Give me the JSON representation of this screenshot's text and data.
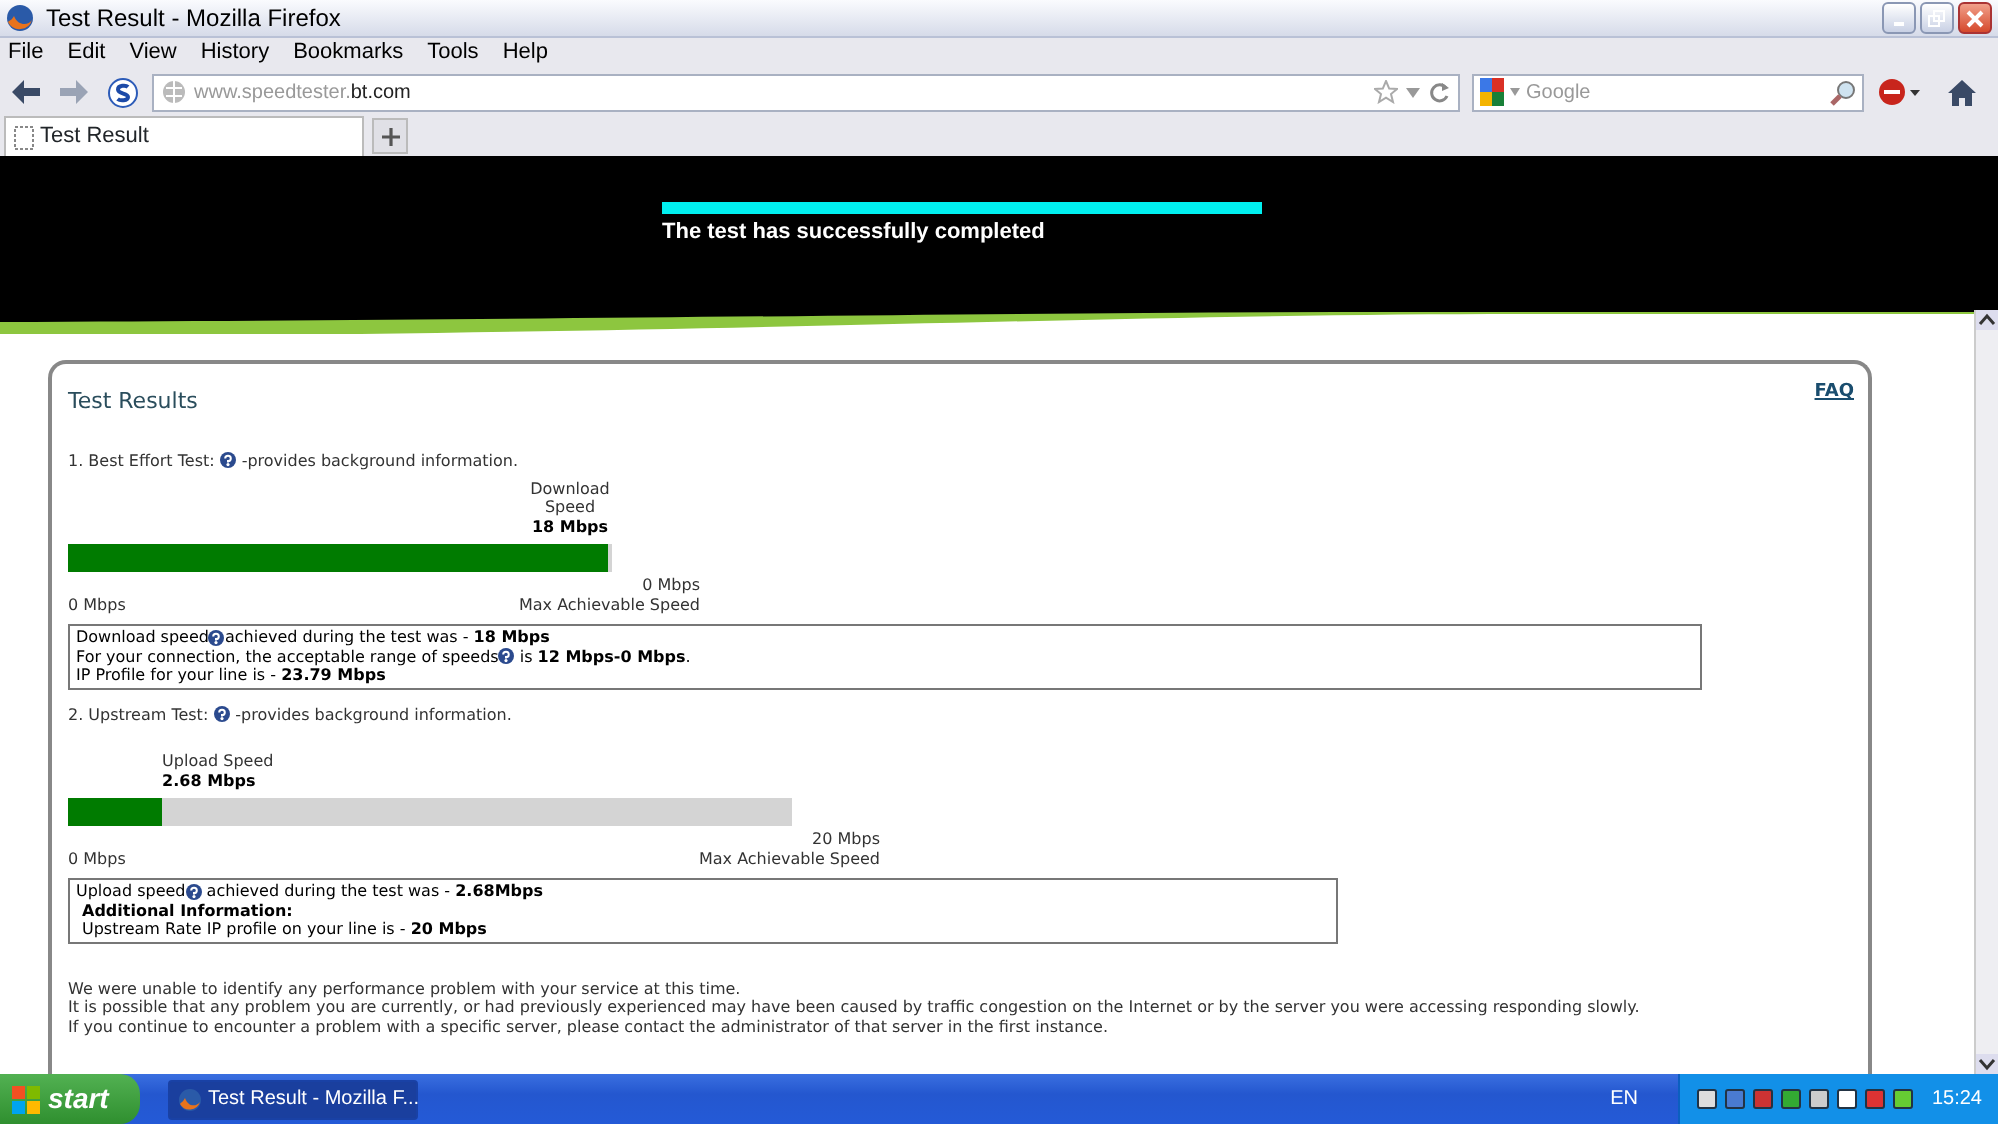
{
  "window": {
    "title": "Test Result - Mozilla Firefox"
  },
  "menu": [
    "File",
    "Edit",
    "View",
    "History",
    "Bookmarks",
    "Tools",
    "Help"
  ],
  "address": {
    "host": "www.speedtester.",
    "domain": "bt.com"
  },
  "search": {
    "placeholder": "Google"
  },
  "tabs": [
    {
      "label": "Test Result",
      "selected": true
    }
  ],
  "banner": {
    "level": 1,
    "message": "The test has successfully completed"
  },
  "results": {
    "title": "Test Results",
    "faq": "FAQ",
    "tests": [
      {
        "heading": "1. Best Effort Test:",
        "help_text": "-provides background information.",
        "bar_label": "Download Speed",
        "bar_value": "18 Mbps",
        "level": 1,
        "min": "0 Mbps",
        "max": "0 Mbps",
        "max_caption": "Max Achievable Speed",
        "info": [
          {
            "before": "Download speed",
            "help": true,
            "after": "achieved during the test was - **18 Mbps**"
          },
          {
            "before": "For your connection, the acceptable range of speeds",
            "help": true,
            "after": " is **12 Mbps-0 Mbps**."
          },
          {
            "before": "IP Profile for your line is - **23.79 Mbps**",
            "help": false
          }
        ]
      },
      {
        "heading": "2. Upstream Test:",
        "help_text": "-provides background information.",
        "bar_label": "Upload Speed",
        "bar_value": "2.68 Mbps",
        "level": 0.13,
        "min": "0 Mbps",
        "max": "20 Mbps",
        "max_caption": "Max Achievable Speed",
        "info": [
          {
            "before": "Upload speed",
            "help": true,
            "after": " achieved during the test was - **2.68Mbps**"
          },
          {
            "before": "Additional Information:",
            "help": false,
            "kind": "heading"
          },
          {
            "before": "Upstream Rate IP profile on your line is - **20 Mbps**",
            "help": false,
            "kind": "indent"
          }
        ]
      }
    ],
    "notes": [
      "We were unable to identify any performance problem with your service at this time.",
      "It is possible that any problem you are currently, or had previously experienced may have been caused by traffic congestion on the Internet or by the server you were accessing responding slowly.",
      "If you continue to encounter a problem with a specific server, please contact the administrator of that server in the first instance."
    ]
  },
  "taskbar": {
    "start": "start",
    "tasks": [
      {
        "label": "Test Result - Mozilla F...",
        "selected": true
      }
    ],
    "language": "EN",
    "clock": "15:24"
  }
}
